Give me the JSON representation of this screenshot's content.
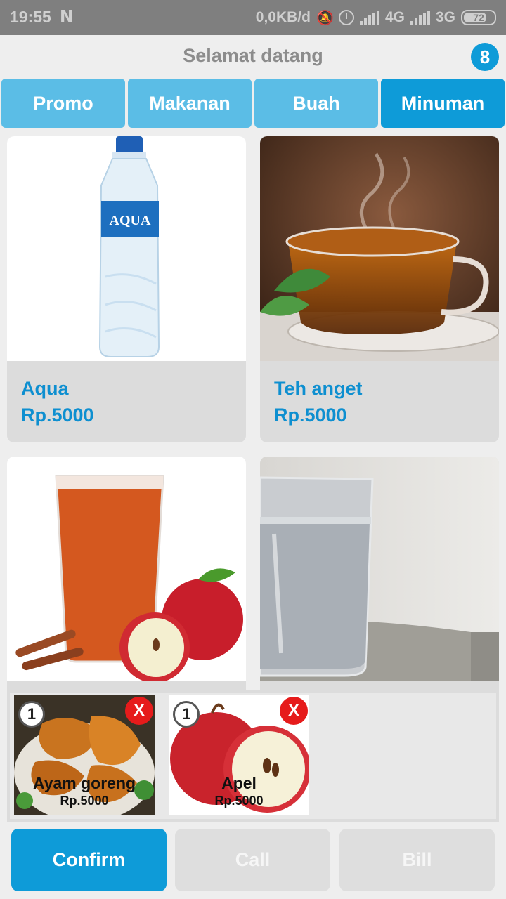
{
  "status_bar": {
    "time": "19:55",
    "notification_icon": "N",
    "network_speed": "0,0KB/d",
    "signal_1_label": "4G",
    "signal_2_label": "3G",
    "battery": "72"
  },
  "header": {
    "title": "Selamat datang",
    "cart_count": "8"
  },
  "tabs": [
    {
      "label": "Promo",
      "active": false
    },
    {
      "label": "Makanan",
      "active": false
    },
    {
      "label": "Buah",
      "active": false
    },
    {
      "label": "Minuman",
      "active": true
    }
  ],
  "products": [
    {
      "name": "Aqua",
      "price": "Rp.5000",
      "image": "water-bottle"
    },
    {
      "name": "Teh anget",
      "price": "Rp.5000",
      "image": "tea-cup"
    },
    {
      "name": "",
      "price": "",
      "image": "apple-juice"
    },
    {
      "name": "",
      "price": "",
      "image": "glass-of-water"
    }
  ],
  "cart": [
    {
      "qty": "1",
      "name": "Ayam goreng",
      "price": "Rp.5000",
      "remove_label": "X",
      "image": "fried-chicken"
    },
    {
      "qty": "1",
      "name": "Apel",
      "price": "Rp.5000",
      "remove_label": "X",
      "image": "apple"
    }
  ],
  "buttons": {
    "confirm": "Confirm",
    "call": "Call",
    "bill": "Bill"
  },
  "colors": {
    "accent": "#0e9bd8",
    "tab": "#5bbde6",
    "remove": "#e61b1b",
    "disabled": "#dedede"
  }
}
